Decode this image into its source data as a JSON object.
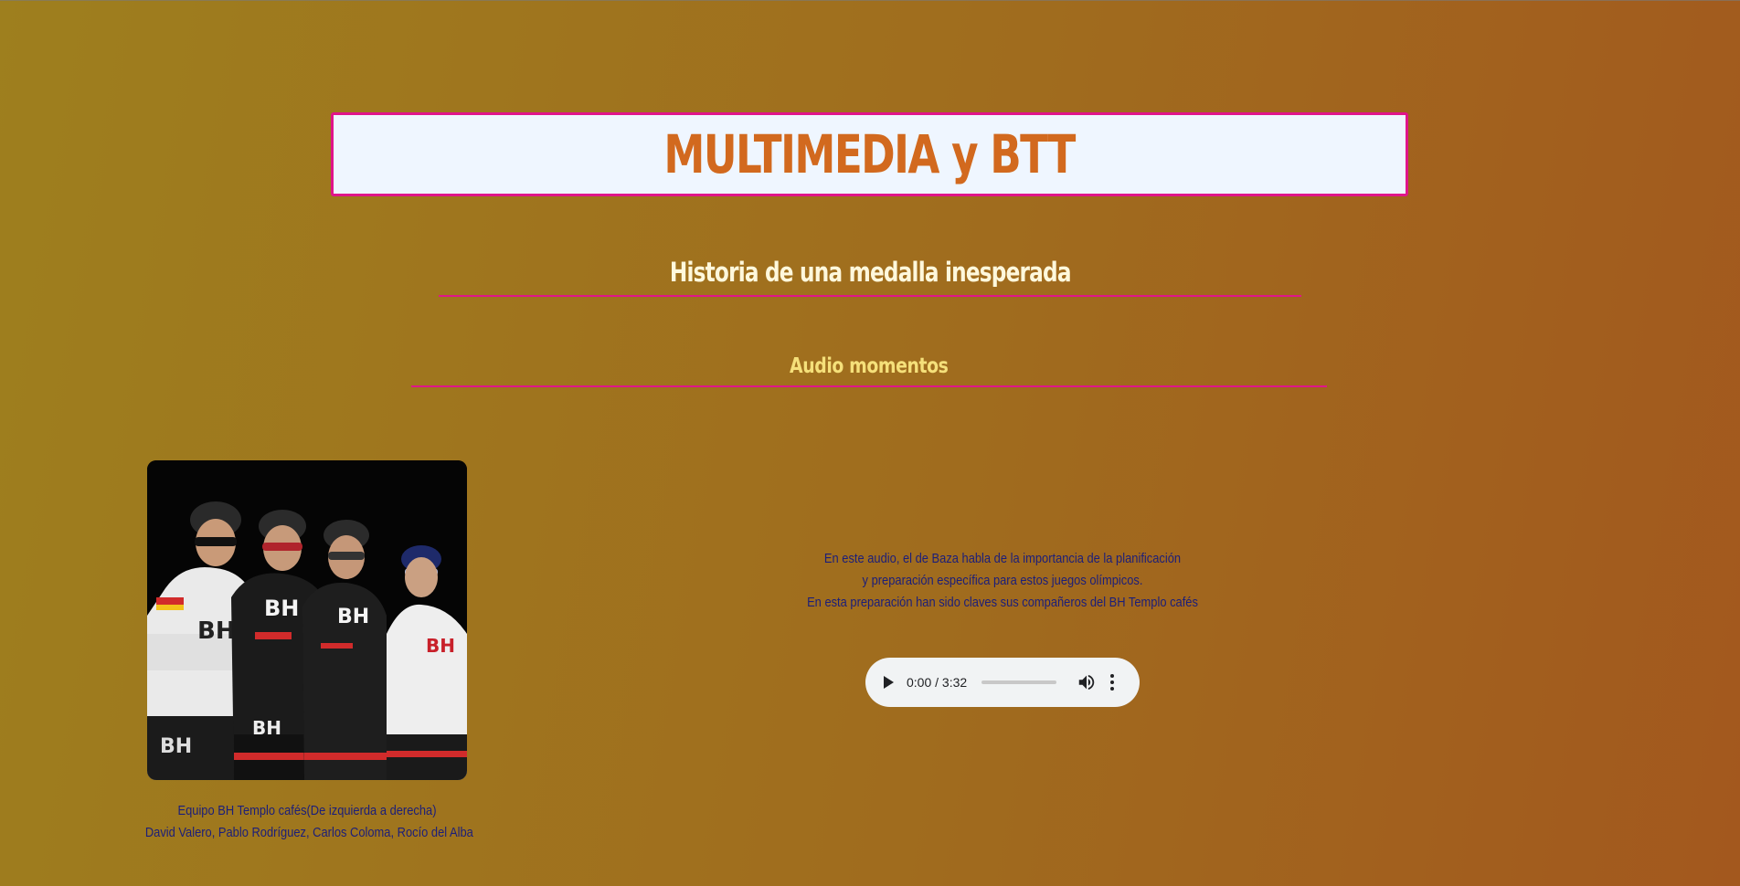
{
  "page": {
    "title": "MULTIMEDIA y BTT",
    "subtitle": "Historia de una medalla inesperada",
    "section_title": "Audio momentos"
  },
  "photo": {
    "alt": "Equipo BH Templo cafés",
    "jersey_text": "BH",
    "caption_line1": "Equipo BH Templo cafés(De izquierda a derecha)",
    "caption_line2": "David Valero, Pablo Rodríguez, Carlos Coloma, Rocío del Alba"
  },
  "description": {
    "line1": "En este audio, el de Baza habla de la importancia de la planificación",
    "line2": "y preparación específica para estos juegos olímpicos.",
    "line3": "En esta preparación han sido claves sus compañeros del BH Templo cafés"
  },
  "audio_player": {
    "time": "0:00 / 3:32",
    "progress": 0,
    "play_icon": "play-icon",
    "volume_icon": "volume-icon",
    "menu_icon": "more-vertical-icon"
  },
  "colors": {
    "title_border": "#e0158a",
    "title_text": "#d2691e",
    "title_bg": "#eff6ff",
    "subtitle_text": "#fff8dc",
    "section_text": "#f5e07a",
    "body_text": "#1b1e7a"
  }
}
